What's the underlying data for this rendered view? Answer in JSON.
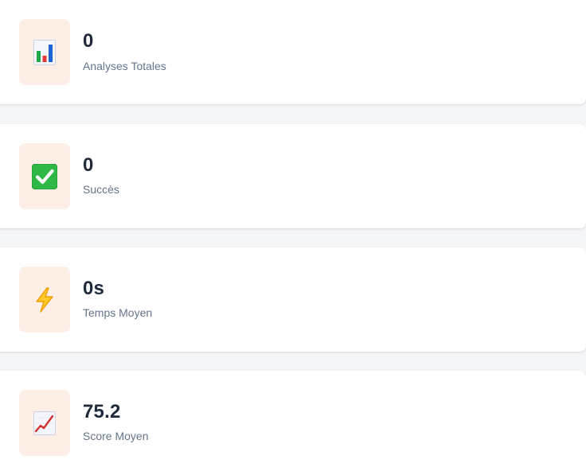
{
  "colors": {
    "page_background": "#f5f6f8",
    "card_background": "#ffffff",
    "icon_background": "#fdeee6",
    "value_text": "#1e293b",
    "label_text": "#64748b"
  },
  "stats": [
    {
      "icon": "bar-chart-icon",
      "value": "0",
      "label": "Analyses Totales"
    },
    {
      "icon": "check-mark-icon",
      "value": "0",
      "label": "Succès"
    },
    {
      "icon": "lightning-icon",
      "value": "0s",
      "label": "Temps Moyen"
    },
    {
      "icon": "trending-up-chart-icon",
      "value": "75.2",
      "label": "Score Moyen"
    }
  ]
}
